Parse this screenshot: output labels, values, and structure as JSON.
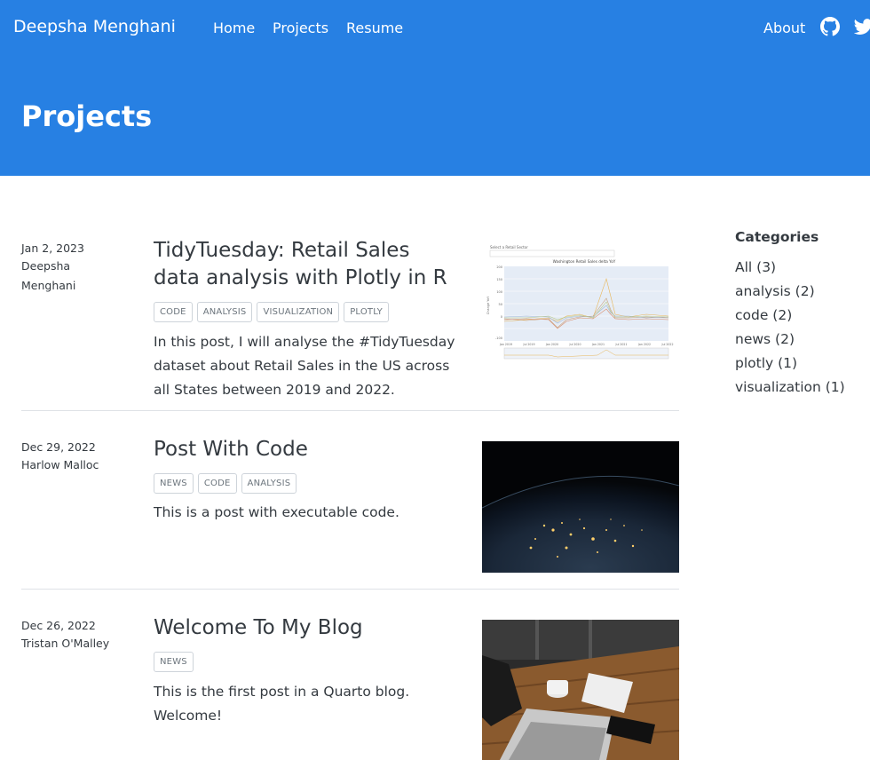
{
  "navbar": {
    "brand": "Deepsha Menghani",
    "links": [
      "Home",
      "Projects",
      "Resume"
    ],
    "right_links": [
      "About"
    ],
    "icons": [
      "github-icon",
      "twitter-icon"
    ],
    "color": "#2780e3"
  },
  "banner": {
    "title": "Projects"
  },
  "posts": [
    {
      "date": "Jan 2, 2023",
      "author": "Deepsha Menghani",
      "title": "TidyTuesday: Retail Sales data analysis with Plotly in R",
      "tags": [
        "CODE",
        "ANALYSIS",
        "VISUALIZATION",
        "PLOTLY"
      ],
      "description": "In this post, I will analyse the #TidyTuesday dataset about Retail Sales in the US across all States between 2019 and 2022.",
      "thumbnail": {
        "dropdown_label": "Select a Retail Sector",
        "chart_title": "Washington Retail Sales delta YoY",
        "ylabel": "Change YoY",
        "y_ticks": [
          "200",
          "150",
          "100",
          "50",
          "0",
          "-100"
        ],
        "x_ticks": [
          "Jan 2019",
          "Jul 2019",
          "Jan 2020",
          "Jul 2020",
          "Jan 2021",
          "Jul 2021",
          "Jan 2022",
          "Jul 2022"
        ]
      }
    },
    {
      "date": "Dec 29, 2022",
      "author": "Harlow Malloc",
      "title": "Post With Code",
      "tags": [
        "NEWS",
        "CODE",
        "ANALYSIS"
      ],
      "description": "This is a post with executable code.",
      "thumbnail": {
        "kind": "earth-night-photo"
      }
    },
    {
      "date": "Dec 26, 2022",
      "author": "Tristan O'Malley",
      "title": "Welcome To My Blog",
      "tags": [
        "NEWS"
      ],
      "description": "This is the first post in a Quarto blog. Welcome!",
      "thumbnail": {
        "kind": "laptop-desk-photo"
      }
    }
  ],
  "sidebar": {
    "heading": "Categories",
    "categories": [
      "All (3)",
      "analysis (2)",
      "code (2)",
      "news (2)",
      "plotly (1)",
      "visualization (1)"
    ]
  }
}
